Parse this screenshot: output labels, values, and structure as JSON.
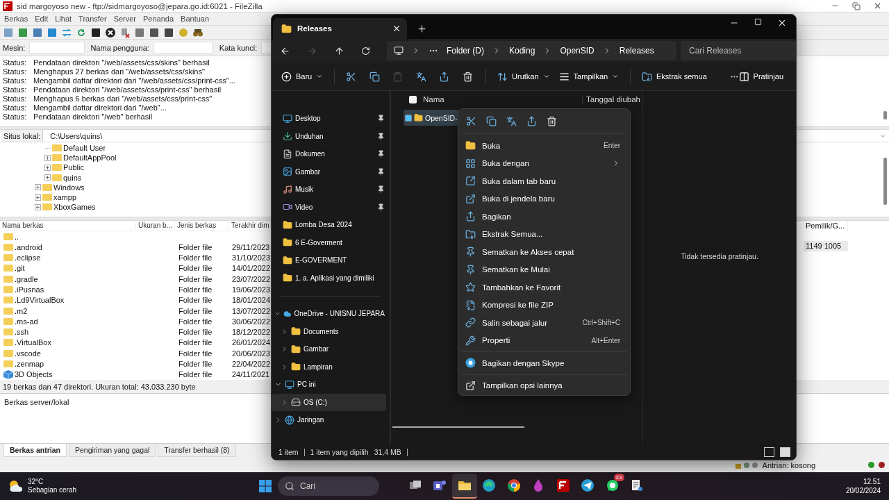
{
  "filezilla": {
    "title": "sid margoyoso new - ftp://sidmargoyoso@jepara.go.id:6021 - FileZilla",
    "menu": [
      "Berkas",
      "Edit",
      "Lihat",
      "Transfer",
      "Server",
      "Penanda",
      "Bantuan"
    ],
    "quickconnect": [
      {
        "label": "Mesin:"
      },
      {
        "label": "Nama pengguna:"
      },
      {
        "label": "Kata kunci:"
      }
    ],
    "log": [
      {
        "label": "Status:",
        "message": "Pendataan direktori \"/web/assets/css/skins\" berhasil"
      },
      {
        "label": "Status:",
        "message": "Menghapus 27 berkas dari \"/web/assets/css/skins\""
      },
      {
        "label": "Status:",
        "message": "Mengambil daftar direktori dari \"/web/assets/css/print-css\"..."
      },
      {
        "label": "Status:",
        "message": "Pendataan direktori \"/web/assets/css/print-css\" berhasil"
      },
      {
        "label": "Status:",
        "message": "Menghapus 6 berkas dari \"/web/assets/css/print-css\""
      },
      {
        "label": "Status:",
        "message": "Mengambil daftar direktori dari \"/web\"..."
      },
      {
        "label": "Status:",
        "message": "Pendataan direktori \"/web\" berhasil"
      }
    ],
    "local_site": {
      "label": "Situs lokal:",
      "path": "C:\\Users\\quins\\"
    },
    "tree": [
      {
        "children": [
          {
            "label": "Default User",
            "expandable": false
          },
          {
            "label": "DefaultAppPool",
            "expandable": true
          },
          {
            "label": "Public",
            "expandable": true
          },
          {
            "label": "quins",
            "expandable": true
          }
        ]
      },
      {
        "label": "Windows",
        "expandable": true
      },
      {
        "label": "xampp",
        "expandable": true
      },
      {
        "label": "XboxGames",
        "expandable": true
      }
    ],
    "columns": [
      "Nama berkas",
      "Ukuran b...",
      "Jenis berkas",
      "Terakhir dim"
    ],
    "files": [
      {
        "name": "..",
        "kind": "folder"
      },
      {
        "name": ".android",
        "kind": "folder",
        "type": "Folder file",
        "modified": "29/11/2023"
      },
      {
        "name": ".eclipse",
        "kind": "folder",
        "type": "Folder file",
        "modified": "31/10/2023"
      },
      {
        "name": ".git",
        "kind": "folder",
        "type": "Folder file",
        "modified": "14/01/2022"
      },
      {
        "name": ".gradle",
        "kind": "folder",
        "type": "Folder file",
        "modified": "23/07/2022"
      },
      {
        "name": ".iPusnas",
        "kind": "folder",
        "type": "Folder file",
        "modified": "19/06/2023"
      },
      {
        "name": ".Ld9VirtualBox",
        "kind": "folder",
        "type": "Folder file",
        "modified": "18/01/2024"
      },
      {
        "name": ".m2",
        "kind": "folder",
        "type": "Folder file",
        "modified": "13/07/2022"
      },
      {
        "name": ".ms-ad",
        "kind": "folder",
        "type": "Folder file",
        "modified": "30/06/2022"
      },
      {
        "name": ".ssh",
        "kind": "folder",
        "type": "Folder file",
        "modified": "18/12/2022"
      },
      {
        "name": ".VirtualBox",
        "kind": "folder",
        "type": "Folder file",
        "modified": "26/01/2024"
      },
      {
        "name": ".vscode",
        "kind": "folder",
        "type": "Folder file",
        "modified": "20/06/2023"
      },
      {
        "name": ".zenmap",
        "kind": "folder",
        "type": "Folder file",
        "modified": "22/04/2022"
      },
      {
        "name": "3D Objects",
        "kind": "objects",
        "type": "Folder file",
        "modified": "24/11/2021"
      }
    ],
    "summary": "19 berkas dan 47 direktori. Ukuran total: 43.033.230 byte",
    "remote_column": "Pemilik/G...",
    "remote_row": "1149 1005",
    "queue_header": "Berkas server/lokal",
    "tabs": [
      {
        "label": "Berkas antrian",
        "selected": true
      },
      {
        "label": "Pengiriman yang gagal",
        "selected": false
      },
      {
        "label": "Transfer berhasil (8)",
        "selected": false
      }
    ],
    "queue_status": "Antrian: kosong"
  },
  "explorer": {
    "tab": "Releases",
    "forward_disabled": true,
    "breadcrumb": [
      "Folder (D)",
      "Koding",
      "OpenSID",
      "Releases"
    ],
    "search": {
      "placeholder": "Cari Releases"
    },
    "toolbar": {
      "new": "Baru",
      "paste_disabled": true,
      "sort": "Urutkan",
      "view": "Tampilkan",
      "extract": "Ekstrak semua",
      "preview": "Pratinjau"
    },
    "quick_access": [
      {
        "label": "Desktop",
        "kind": "desktop",
        "pinned": true
      },
      {
        "label": "Unduhan",
        "kind": "download",
        "pinned": true
      },
      {
        "label": "Dokumen",
        "kind": "document",
        "pinned": true
      },
      {
        "label": "Gambar",
        "kind": "picture",
        "pinned": true
      },
      {
        "label": "Musik",
        "kind": "music",
        "pinned": true
      },
      {
        "label": "Video",
        "kind": "video",
        "pinned": true
      },
      {
        "label": "Lomba Desa 2024",
        "kind": "folder",
        "pinned": false
      },
      {
        "label": "6 E-Goverment",
        "kind": "folder",
        "pinned": false
      },
      {
        "label": "E-GOVERMENT",
        "kind": "folder",
        "pinned": false
      },
      {
        "label": "1. a. Aplikasi yang dimiliki",
        "kind": "folder",
        "pinned": false
      }
    ],
    "tree": [
      {
        "label": "OneDrive - UNISNU JEPARA",
        "kind": "cloud",
        "expanded": true,
        "selected": false,
        "children": [
          {
            "label": "Documents",
            "kind": "folder",
            "expanded": false,
            "selected": false
          },
          {
            "label": "Gambar",
            "kind": "folder",
            "expanded": false,
            "selected": false
          },
          {
            "label": "Lampiran",
            "kind": "folder",
            "expanded": false,
            "selected": false
          }
        ]
      },
      {
        "label": "PC ini",
        "kind": "pc",
        "expanded": true,
        "selected": false,
        "children": [
          {
            "label": "OS (C:)",
            "kind": "drive",
            "expanded": false,
            "selected": true
          }
        ]
      },
      {
        "label": "Jaringan",
        "kind": "network",
        "expanded": false,
        "selected": false
      }
    ],
    "select_all": {
      "checked": false
    },
    "columns": [
      "Nama",
      "Tanggal diubah"
    ],
    "files": [
      {
        "name": "OpenSID-",
        "selected": true
      }
    ],
    "status": {
      "count": "1 item",
      "selection": "1 item yang dipilih",
      "size": "31,4 MB"
    },
    "preview_text": "Tidak tersedia pratinjau.",
    "context_menu": {
      "sections": [
        [
          {
            "label": "Buka",
            "shortcut": "Enter",
            "submenu": false
          },
          {
            "label": "Buka dengan",
            "submenu": true
          },
          {
            "label": "Buka dalam tab baru",
            "submenu": false
          },
          {
            "label": "Buka di jendela baru",
            "submenu": false
          },
          {
            "label": "Bagikan",
            "submenu": false
          },
          {
            "label": "Ekstrak Semua...",
            "submenu": false
          },
          {
            "label": "Sematkan ke Akses cepat",
            "submenu": false
          },
          {
            "label": "Sematkan ke Mulai",
            "submenu": false
          },
          {
            "label": "Tambahkan ke Favorit",
            "submenu": false
          },
          {
            "label": "Kompresi ke file ZIP",
            "submenu": false
          },
          {
            "label": "Salin sebagai jalur",
            "shortcut": "Ctrl+Shift+C",
            "submenu": false
          },
          {
            "label": "Properti",
            "shortcut": "Alt+Enter",
            "submenu": false
          }
        ],
        [
          {
            "label": "Bagikan dengan Skype",
            "submenu": false
          }
        ],
        [
          {
            "label": "Tampilkan opsi lainnya",
            "submenu": false
          }
        ]
      ]
    }
  },
  "taskbar": {
    "weather": {
      "temp": "32°C",
      "text": "Sebagian cerah"
    },
    "search": {
      "placeholder": "Cari"
    },
    "apps": [
      {
        "kind": "taskview",
        "active": false
      },
      {
        "kind": "teams",
        "active": false
      },
      {
        "kind": "explorer",
        "active": true
      },
      {
        "kind": "edge",
        "active": false
      },
      {
        "kind": "chrome",
        "active": false
      },
      {
        "kind": "drop",
        "active": false
      },
      {
        "kind": "filezilla",
        "active": false
      },
      {
        "kind": "telegram",
        "active": false
      },
      {
        "kind": "whatsapp",
        "active": false,
        "badge": "23"
      },
      {
        "kind": "tool",
        "active": false
      }
    ],
    "clock": {
      "time": "12.51",
      "date": "20/02/2024"
    }
  }
}
